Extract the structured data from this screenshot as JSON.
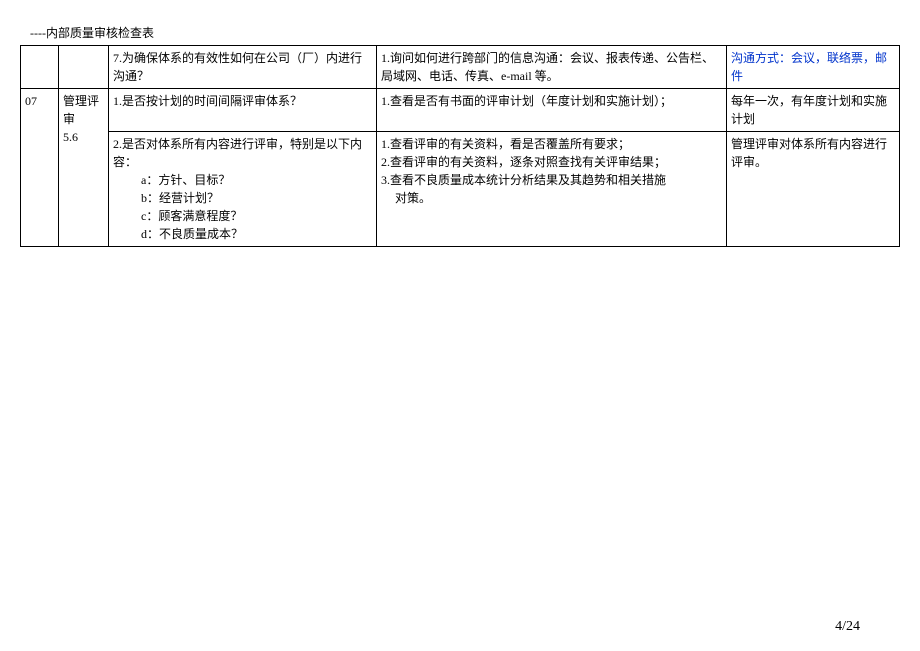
{
  "page_title": "----内部质量审核检查表",
  "page_number": "4/24",
  "rows": [
    {
      "id": "",
      "cat": "",
      "question": "7.为确保体系的有效性如何在公司（厂）内进行沟通？",
      "method": "1.询问如何进行跨部门的信息沟通：会议、报表传递、公告栏、局域网、电话、传真、e-mail 等。",
      "result": "沟通方式：会议，联络票，邮件"
    },
    {
      "id": "07",
      "cat_line1": "管理评",
      "cat_line2": "审",
      "cat_line3": "5.6",
      "question": "1.是否按计划的时间间隔评审体系？",
      "method": "1.查看是否有书面的评审计划（年度计划和实施计划）；",
      "result": "每年一次，有年度计划和实施计划"
    },
    {
      "question_line1": "2.是否对体系所有内容进行评审，特别是以下内容：",
      "question_a": "a：方针、目标？",
      "question_b": "b：经营计划？",
      "question_c": "c：顾客满意程度？",
      "question_d": "d：不良质量成本？",
      "method_line1": "1.查看评审的有关资料，看是否覆盖所有要求；",
      "method_line2": "2.查看评审的有关资料，逐条对照查找有关评审结果；",
      "method_line3": "3.查看不良质量成本统计分析结果及其趋势和相关措施",
      "method_line3b": "对策。",
      "result": "管理评审对体系所有内容进行评审。"
    }
  ]
}
